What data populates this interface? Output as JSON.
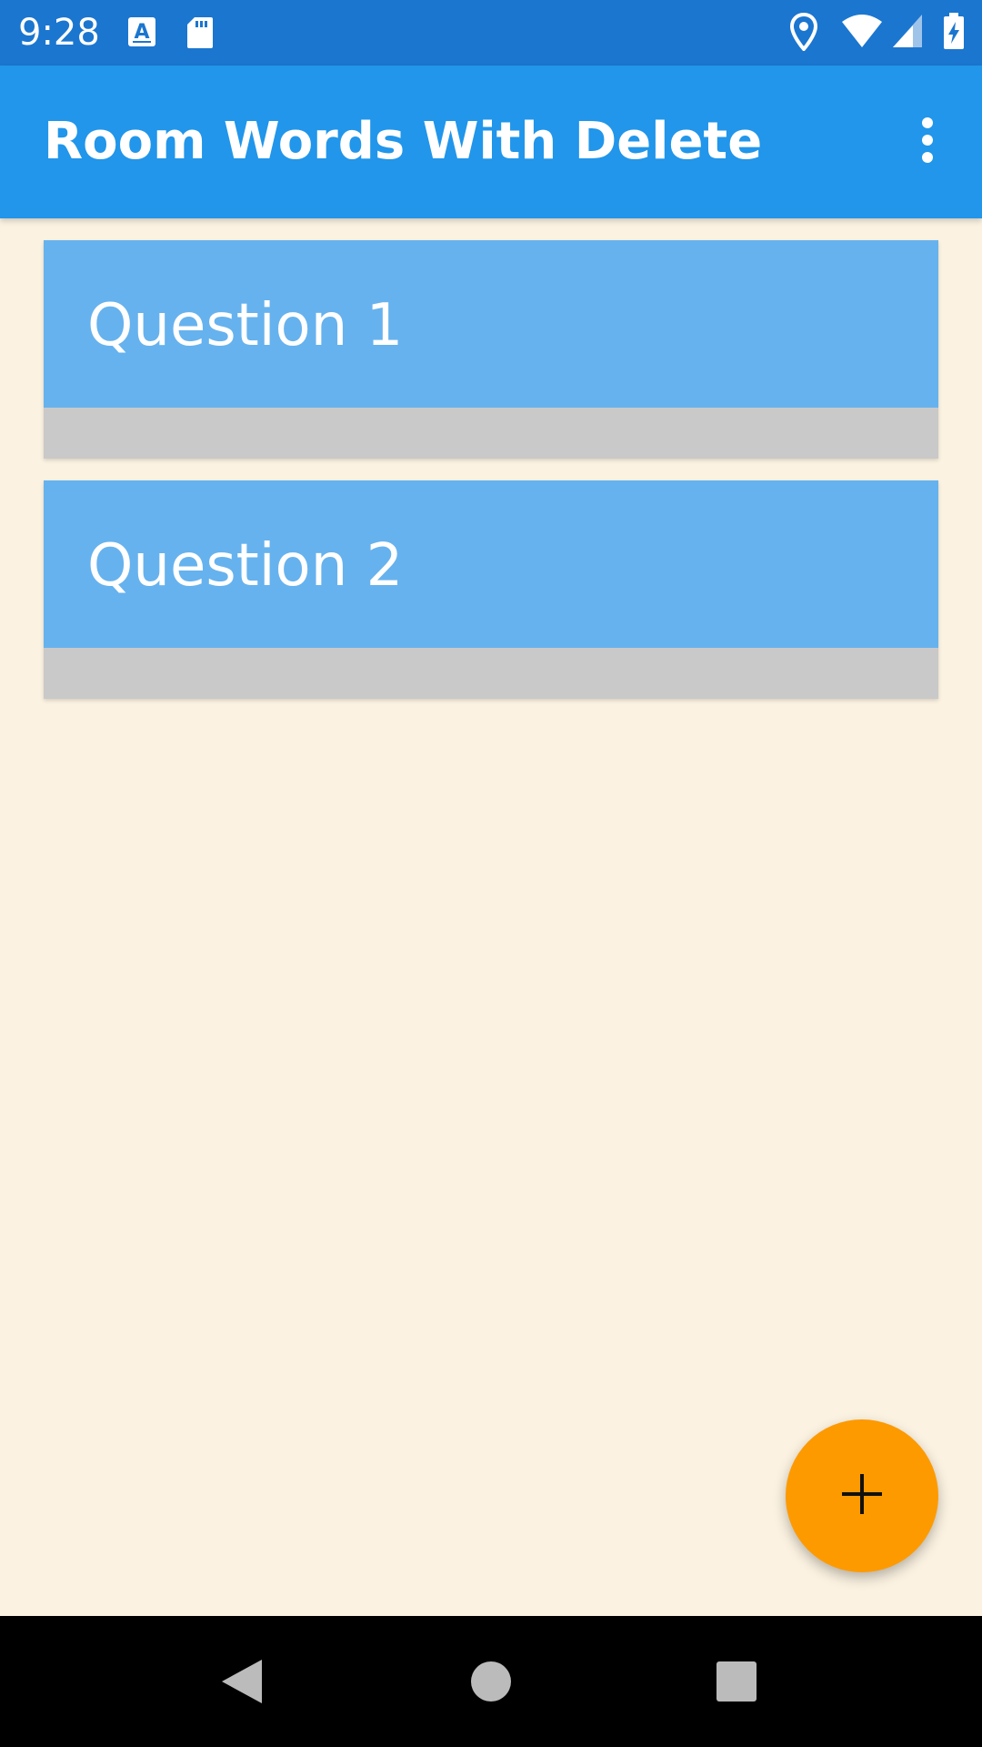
{
  "status_bar": {
    "time": "9:28",
    "left_icons": [
      "font-a-icon",
      "sd-card-icon"
    ],
    "right_icons": [
      "location-pin-icon",
      "wifi-icon",
      "cellular-signal-icon",
      "battery-charging-icon"
    ]
  },
  "app_bar": {
    "title": "Room Words With Delete",
    "overflow_icon": "more-vert-icon"
  },
  "list": {
    "items": [
      {
        "label": "Question 1"
      },
      {
        "label": "Question 2"
      }
    ]
  },
  "fab": {
    "icon": "plus-icon"
  },
  "nav_bar": {
    "buttons": [
      "back-icon",
      "home-icon",
      "recents-icon"
    ]
  },
  "colors": {
    "status_bar": "#1b76cf",
    "app_bar": "#2196ea",
    "card_top": "#66b2ee",
    "card_bottom": "#c9c9c9",
    "background": "#fbf2e1",
    "fab": "#fd9a00"
  }
}
